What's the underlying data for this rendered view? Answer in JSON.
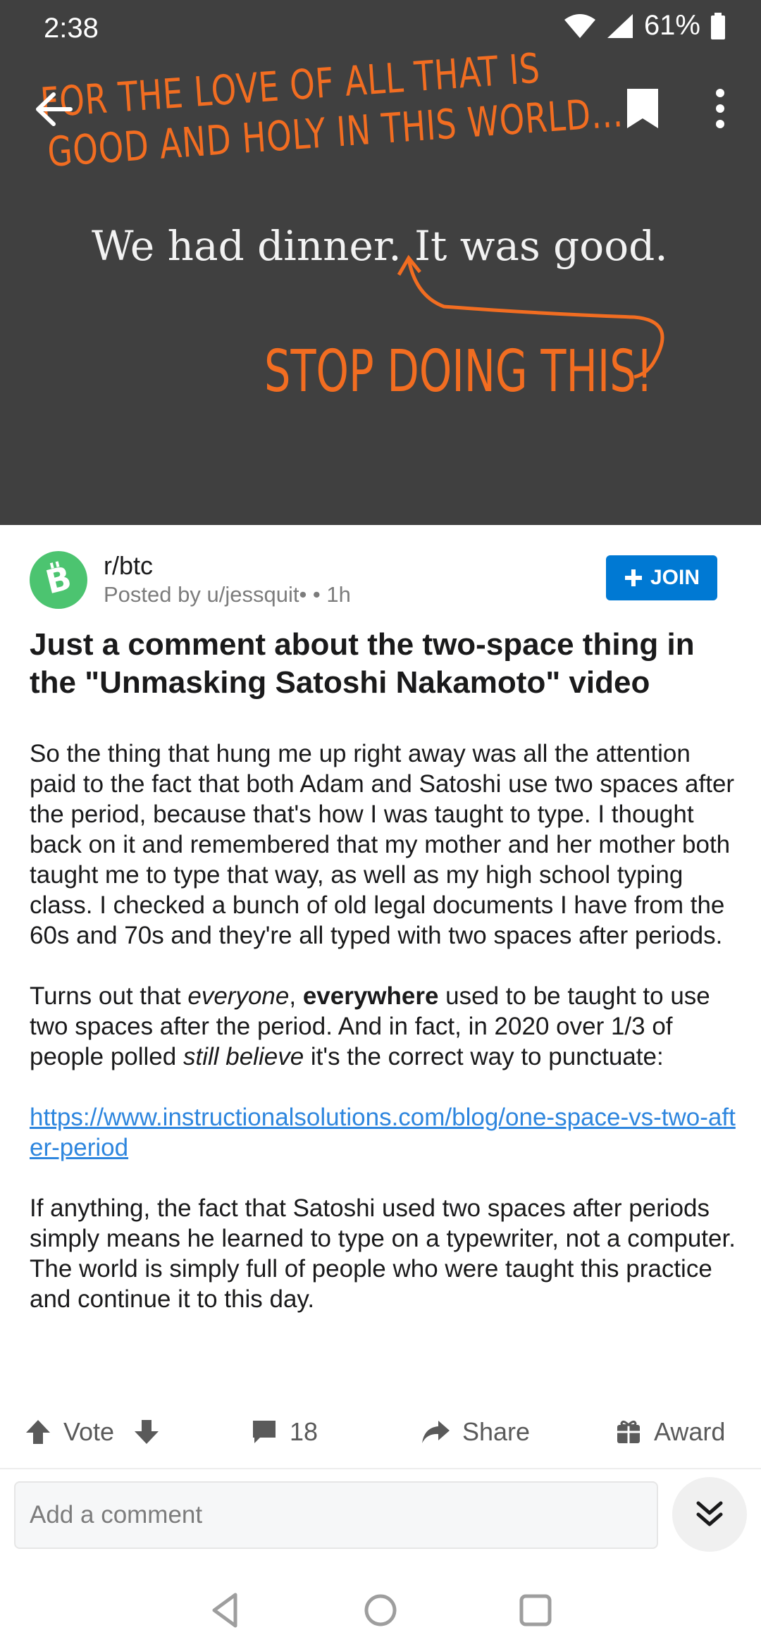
{
  "status_bar": {
    "time": "2:38",
    "battery": "61%"
  },
  "image": {
    "line1": "FOR THE LOVE OF ALL THAT IS",
    "line2": "GOOD AND HOLY IN THIS WORLD...",
    "main_text": "We had dinner.  It was good.",
    "stop_text": "STOP DOING THIS!"
  },
  "post": {
    "subreddit": "r/btc",
    "posted_by": "Posted by u/jessquit•  • 1h",
    "join_label": "JOIN",
    "title": "Just a comment about the two-space thing in the \"Unmasking Satoshi Nakamoto\" video",
    "para1": "So the thing that hung me up right away was all the attention paid to the fact that both Adam and Satoshi use two spaces after the period, because that's how I was taught to type. I thought back on it and remembered that my mother and her mother both taught me to type that way, as well as my high school typing class. I checked a bunch of old legal documents I have from the 60s and 70s and they're all typed with two spaces after periods.",
    "para2_a": "Turns out that ",
    "para2_em1": "everyone",
    "para2_b": ", ",
    "para2_strong": "everywhere",
    "para2_c": " used to be taught to use two spaces after the period. And in fact, in 2020 over 1/3 of people polled ",
    "para2_em2": "still believe",
    "para2_d": " it's the correct way to punctuate:",
    "link": "https://www.instructionalsolutions.com/blog/one-space-vs-two-after-period",
    "para3": "If anything, the fact that Satoshi used two spaces after periods simply means he learned to type on a typewriter, not a computer. The world is simply full of people who were taught this practice and continue it to this day."
  },
  "actions": {
    "vote": "Vote",
    "comments": "18",
    "share": "Share",
    "award": "Award"
  },
  "comment_box": {
    "placeholder": "Add a comment"
  }
}
